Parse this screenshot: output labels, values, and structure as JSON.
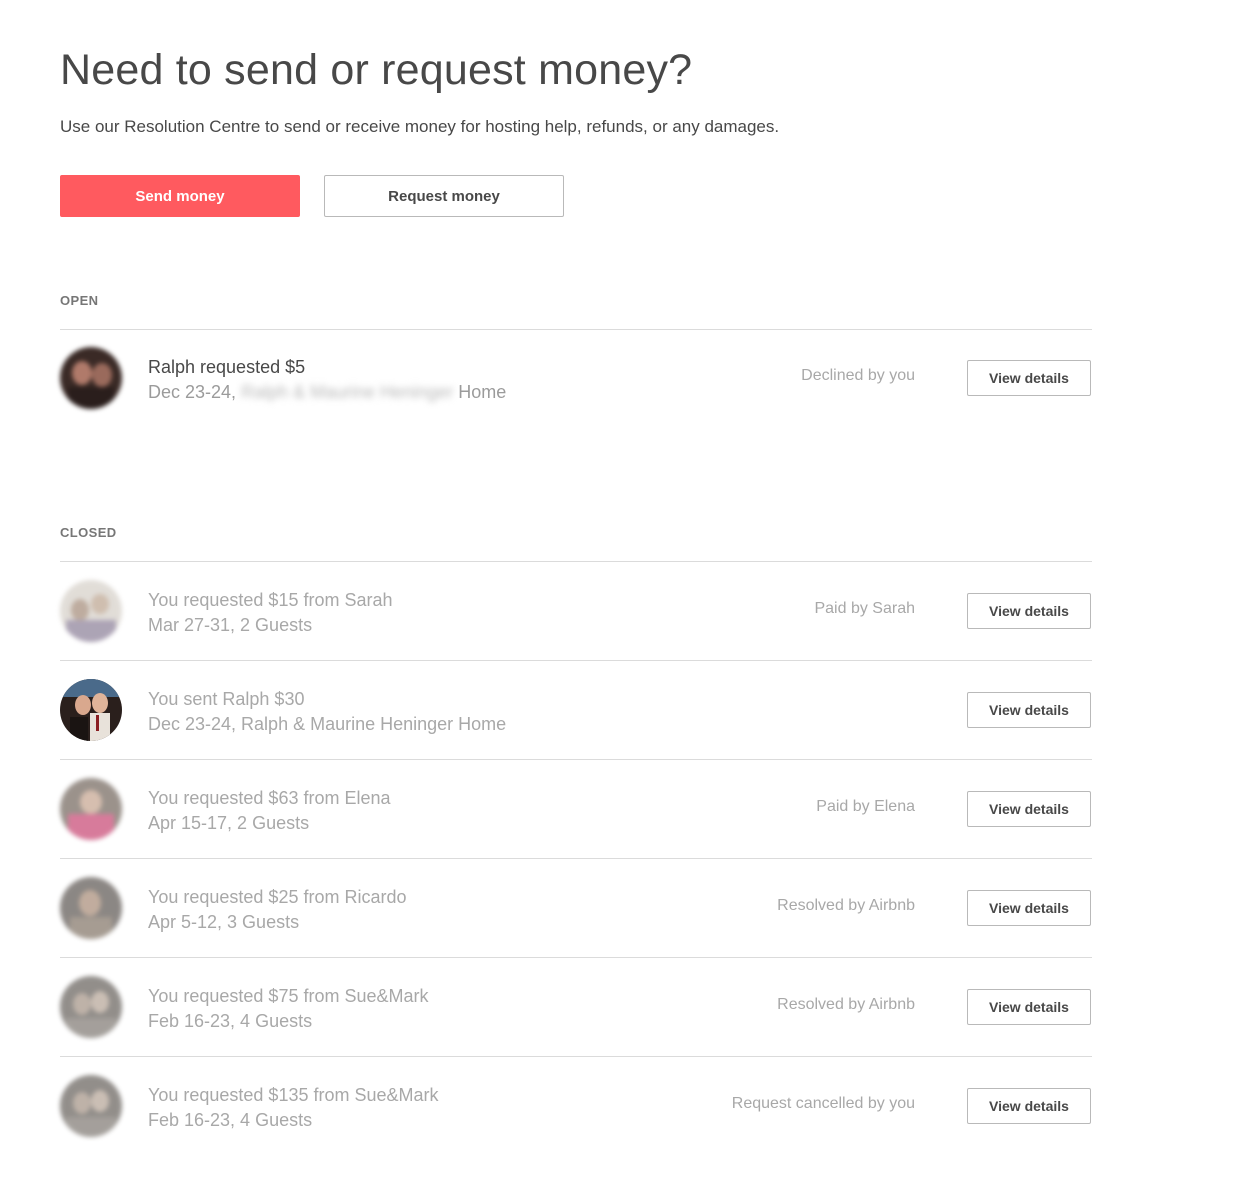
{
  "header": {
    "title": "Need to send or request money?",
    "subtitle": "Use our Resolution Centre to send or receive money for hosting help, refunds, or any damages."
  },
  "actions": {
    "send_label": "Send money",
    "request_label": "Request money",
    "accent_color": "#ff5a5f"
  },
  "open": {
    "label": "OPEN",
    "items": [
      {
        "title": "Ralph requested $5",
        "dates": "Dec 23-24,",
        "listing_blurred": "Ralph & Maurine Heninger",
        "listing_suffix": "Home",
        "status": "Declined by you",
        "button": "View details"
      }
    ]
  },
  "closed": {
    "label": "CLOSED",
    "items": [
      {
        "title": "You requested $15 from Sarah",
        "subtitle": "Mar 27-31, 2 Guests",
        "status": "Paid by Sarah",
        "button": "View details"
      },
      {
        "title": "You sent Ralph $30",
        "subtitle": "Dec 23-24, Ralph & Maurine Heninger Home",
        "status": "",
        "button": "View details"
      },
      {
        "title": "You requested $63 from Elena",
        "subtitle": "Apr 15-17, 2 Guests",
        "status": "Paid by Elena",
        "button": "View details"
      },
      {
        "title": "You requested $25 from Ricardo",
        "subtitle": "Apr 5-12, 3 Guests",
        "status": "Resolved by Airbnb",
        "button": "View details"
      },
      {
        "title": "You requested $75 from Sue&Mark",
        "subtitle": "Feb 16-23, 4 Guests",
        "status": "Resolved by Airbnb",
        "button": "View details"
      },
      {
        "title": "You requested $135 from Sue&Mark",
        "subtitle": "Feb 16-23, 4 Guests",
        "status": "Request cancelled by you",
        "button": "View details"
      }
    ]
  }
}
